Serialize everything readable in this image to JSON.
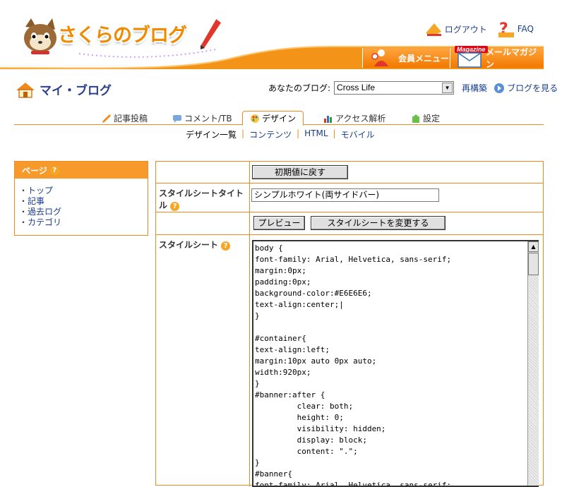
{
  "header": {
    "logo_text": "さくらのブログ",
    "logout": "ログアウト",
    "faq": "FAQ",
    "member_menu": "会員メニュー",
    "magazine_badge": "Magazine",
    "mail_magazine": "メールマガジン",
    "accent_color": "#f08a1e"
  },
  "myblog": {
    "title": "マイ・ブログ",
    "your_blog_label": "あなたのブログ:",
    "selected_blog": "Cross Life",
    "rebuild": "再構築",
    "view_blog": "ブログを見る"
  },
  "tabs": [
    {
      "label": "記事投稿",
      "icon": "pencil-icon"
    },
    {
      "label": "コメント/TB",
      "icon": "comment-icon"
    },
    {
      "label": "デザイン",
      "icon": "palette-icon",
      "active": true
    },
    {
      "label": "アクセス解析",
      "icon": "bar-chart-icon"
    },
    {
      "label": "設定",
      "icon": "puzzle-icon"
    }
  ],
  "subnav": {
    "design_list": "デザイン一覧",
    "contents": "コンテンツ",
    "html": "HTML",
    "mobile": "モバイル",
    "separator": "|"
  },
  "sidebar": {
    "title": "ページ",
    "items": [
      "トップ",
      "記事",
      "過去ログ",
      "カテゴリ"
    ]
  },
  "form": {
    "reset_button": "初期値に戻す",
    "stylesheet_title_label": "スタイルシートタイトル",
    "stylesheet_title_value": "シンプルホワイト(両サイドバー)",
    "preview_button": "プレビュー",
    "change_button": "スタイルシートを変更する",
    "stylesheet_label": "スタイルシート",
    "stylesheet_code": "body {\nfont-family: Arial, Helvetica, sans-serif;\nmargin:0px;\npadding:0px;\nbackground-color:#E6E6E6;\ntext-align:center;|\n}\n\n#container{\ntext-align:left;\nmargin:10px auto 0px auto;\nwidth:920px;\n}\n#banner:after {\n         clear: both;\n         height: 0;\n         visibility: hidden;\n         display: block;\n         content: \".\";\n}\n#banner{\nfont-family: Arial, Helvetica, sans-serif;"
  },
  "help_glyph": "?"
}
